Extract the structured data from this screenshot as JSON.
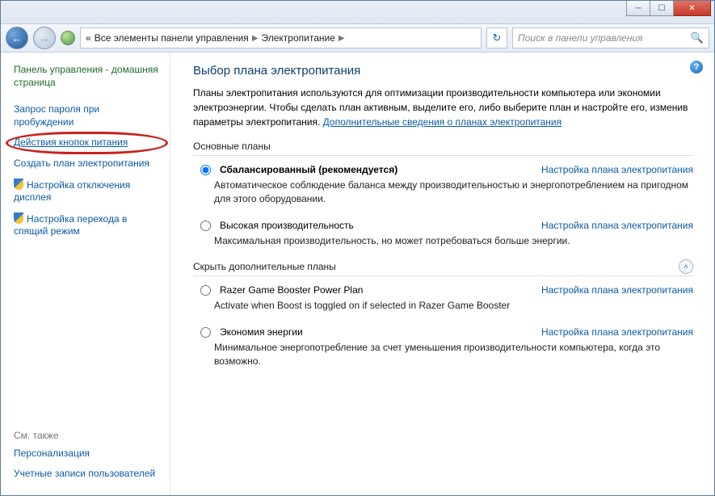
{
  "breadcrumbs": {
    "prefix": "«",
    "part1": "Все элементы панели управления",
    "part2": "Электропитание"
  },
  "search_placeholder": "Поиск в панели управления",
  "sidebar": {
    "home": "Панель управления - домашняя страница",
    "links": [
      "Запрос пароля при пробуждении",
      "Действия кнопок питания",
      "Создать план электропитания",
      "Настройка отключения дисплея",
      "Настройка перехода в спящий режим"
    ],
    "see_also_header": "См. также",
    "see_also": [
      "Персонализация",
      "Учетные записи пользователей"
    ]
  },
  "main": {
    "title": "Выбор плана электропитания",
    "intro_a": "Планы электропитания используются для оптимизации производительности компьютера или экономии электроэнергии. Чтобы сделать план активным, выделите его, либо выберите план и настройте его, изменив параметры электропитания. ",
    "intro_link": "Дополнительные сведения о планах электропитания",
    "section_main": "Основные планы",
    "section_extra": "Скрыть дополнительные планы",
    "plan_link": "Настройка плана электропитания",
    "plans_main": [
      {
        "name": "Сбалансированный (рекомендуется)",
        "desc": "Автоматическое соблюдение баланса между производительностью и энергопотреблением на пригодном для этого оборудовании.",
        "selected": true
      },
      {
        "name": "Высокая производительность",
        "desc": "Максимальная производительность, но может потребоваться больше энергии.",
        "selected": false
      }
    ],
    "plans_extra": [
      {
        "name": "Razer Game Booster Power Plan",
        "desc": "Activate when Boost is toggled on if selected in Razer Game Booster",
        "selected": false
      },
      {
        "name": "Экономия энергии",
        "desc": "Минимальное энергопотребление за счет уменьшения производительности компьютера, когда это возможно.",
        "selected": false
      }
    ]
  }
}
